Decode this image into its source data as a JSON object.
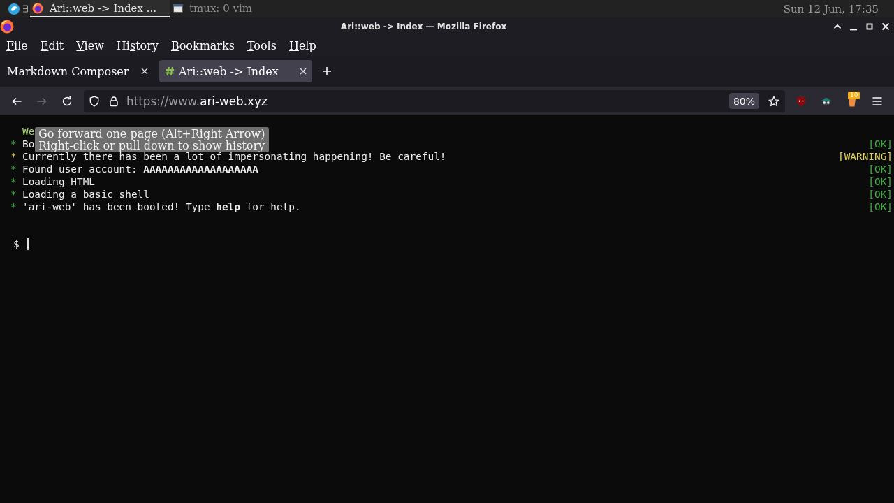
{
  "taskbar": {
    "items": [
      {
        "kind": "browser",
        "title": "Ari::web -> Index ...",
        "selected": true
      },
      {
        "kind": "terminal",
        "title": "tmux: 0 vim",
        "selected": false
      }
    ],
    "clock": "Sun 12 Jun, 17:35"
  },
  "window": {
    "title": "Ari::web -> Index — Mozilla Firefox"
  },
  "menu": [
    {
      "parts": [
        {
          "text": "F",
          "underline": true
        },
        {
          "text": "ile",
          "underline": false
        }
      ]
    },
    {
      "parts": [
        {
          "text": "E",
          "underline": true
        },
        {
          "text": "dit",
          "underline": false
        }
      ]
    },
    {
      "parts": [
        {
          "text": "V",
          "underline": true
        },
        {
          "text": "iew",
          "underline": false
        }
      ]
    },
    {
      "parts": [
        {
          "text": "Hi",
          "underline": false
        },
        {
          "text": "s",
          "underline": true
        },
        {
          "text": "tory",
          "underline": false
        }
      ]
    },
    {
      "parts": [
        {
          "text": "B",
          "underline": true
        },
        {
          "text": "ookmarks",
          "underline": false
        }
      ]
    },
    {
      "parts": [
        {
          "text": "T",
          "underline": true
        },
        {
          "text": "ools",
          "underline": false
        }
      ]
    },
    {
      "parts": [
        {
          "text": "H",
          "underline": true
        },
        {
          "text": "elp",
          "underline": false
        }
      ]
    }
  ],
  "tabs": [
    {
      "title": "Markdown Composer",
      "selected": false,
      "favicon": false
    },
    {
      "title": "Ari::web -> Index",
      "selected": true,
      "favicon": true
    }
  ],
  "toolbar": {
    "nav_buttons": [
      {
        "kind": "back",
        "disabled": false
      },
      {
        "kind": "forward",
        "disabled": true
      },
      {
        "kind": "reload",
        "disabled": false
      }
    ],
    "url": {
      "prefix": "https://www.",
      "domain": "ari-web.xyz"
    },
    "zoom": "80%",
    "extensions": [
      {
        "kind": "shield"
      },
      {
        "kind": "spy"
      },
      {
        "kind": "bucket",
        "badge": "10"
      }
    ]
  },
  "tooltip": {
    "lines": [
      "Go forward one page (Alt+Right Arrow)",
      "Right-click or pull down to show history"
    ]
  },
  "terminal": {
    "lines": [
      {
        "kind": "banner",
        "text": "We"
      },
      {
        "kind": "ok",
        "bullet": "*",
        "text": "Bo",
        "status": "[OK]"
      },
      {
        "kind": "warning",
        "bullet": "*",
        "text": "Currently there has been a lot of impersonating happening! Be careful!",
        "status": "[WARNING]"
      },
      {
        "kind": "ok",
        "bullet": "*",
        "text": "Found user account: **AAAAAAAAAAAAAAAAAAA**",
        "status": "[OK]"
      },
      {
        "kind": "ok",
        "bullet": "*",
        "text": "Loading HTML",
        "status": "[OK]"
      },
      {
        "kind": "ok",
        "bullet": "*",
        "text": "Loading a basic shell",
        "status": "[OK]"
      },
      {
        "kind": "ok",
        "bullet": "*",
        "text": "'ari-web' has been booted! Type **help** for help.",
        "status": "[OK]"
      }
    ],
    "prompt": "$"
  }
}
